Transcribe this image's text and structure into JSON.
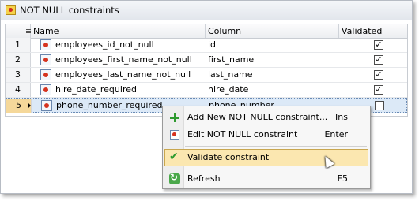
{
  "panel": {
    "title": "NOT NULL constraints"
  },
  "grid": {
    "headers": {
      "name": "Name",
      "column": "Column",
      "validated": "Validated"
    },
    "rows": [
      {
        "num": "1",
        "name": "employees_id_not_null",
        "column": "id",
        "validated": true
      },
      {
        "num": "2",
        "name": "employees_first_name_not_null",
        "column": "first_name",
        "validated": true
      },
      {
        "num": "3",
        "name": "employees_last_name_not_null",
        "column": "last_name",
        "validated": true
      },
      {
        "num": "4",
        "name": "hire_date_required",
        "column": "hire_date",
        "validated": true
      },
      {
        "num": "5",
        "name": "phone_number_required",
        "column": "phone_number",
        "validated": false
      }
    ]
  },
  "context_menu": {
    "items": [
      {
        "label": "Add New NOT NULL constraint...",
        "shortcut": "Ins",
        "icon": "add-icon"
      },
      {
        "label": "Edit NOT NULL constraint",
        "shortcut": "Enter",
        "icon": "edit-icon"
      },
      {
        "label": "Validate constraint",
        "shortcut": "",
        "icon": "check-icon"
      },
      {
        "label": "Refresh",
        "shortcut": "F5",
        "icon": "refresh-icon"
      }
    ]
  },
  "colors": {
    "accent_hover": "#fbe7b0",
    "selection": "#dce9f7"
  }
}
